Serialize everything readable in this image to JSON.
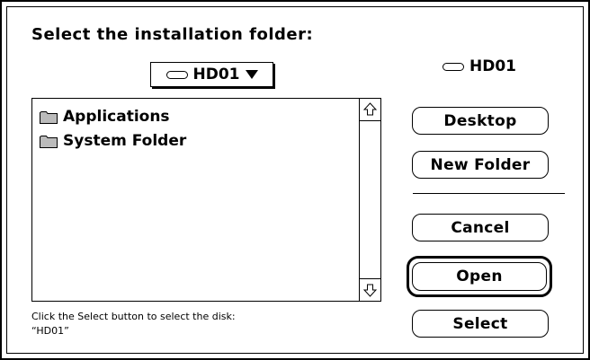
{
  "dialog": {
    "prompt": "Select the installation folder:",
    "popup": {
      "selected": "HD01"
    },
    "current_volume": "HD01",
    "list": {
      "items": [
        {
          "name": "Applications",
          "icon": "folder-icon"
        },
        {
          "name": "System Folder",
          "icon": "folder-icon"
        }
      ]
    },
    "buttons": {
      "desktop": "Desktop",
      "new_folder": "New Folder",
      "cancel": "Cancel",
      "open": "Open",
      "select": "Select"
    },
    "hint_line1": "Click the Select button to select the disk:",
    "hint_line2": "“HD01”"
  }
}
